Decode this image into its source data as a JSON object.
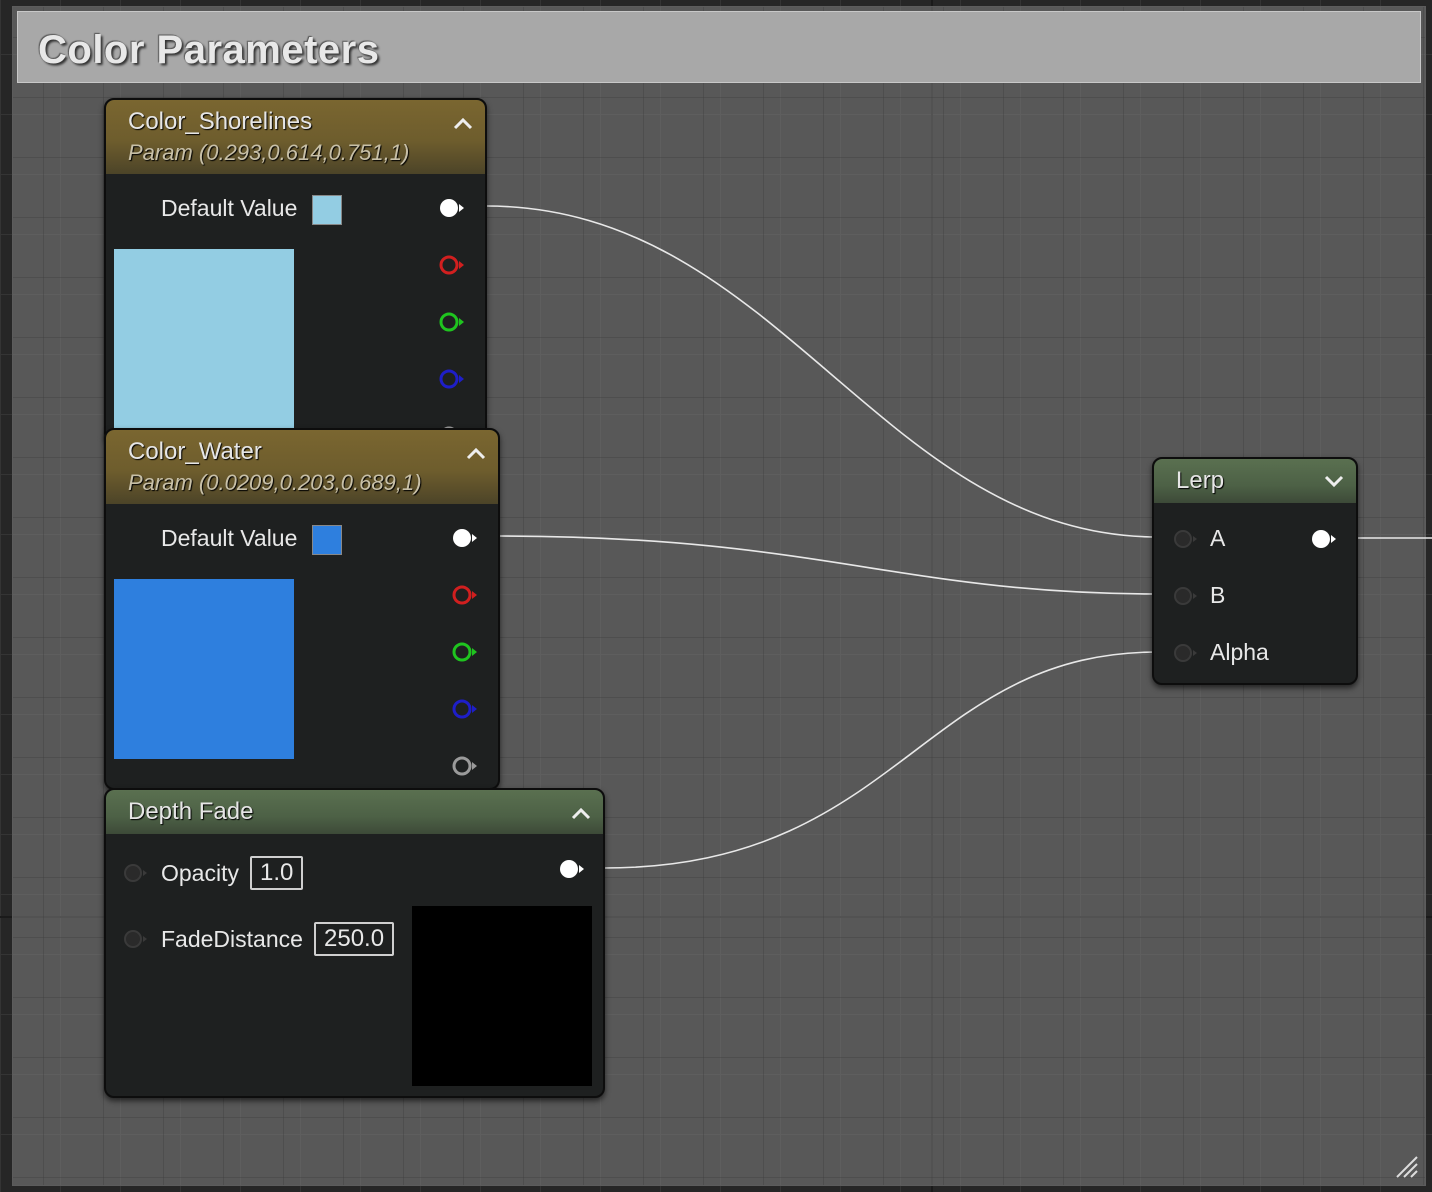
{
  "comment": {
    "title": "Color Parameters"
  },
  "nodes": {
    "shorelines": {
      "title": "Color_Shorelines",
      "subtitle": "Param (0.293,0.614,0.751,1)",
      "default_label": "Default Value",
      "color": "#93cde3"
    },
    "water": {
      "title": "Color_Water",
      "subtitle": "Param (0.0209,0.203,0.689,1)",
      "default_label": "Default Value",
      "color": "#2e7fde"
    },
    "depth_fade": {
      "title": "Depth Fade",
      "opacity_label": "Opacity",
      "opacity_value": "1.0",
      "fade_label": "FadeDistance",
      "fade_value": "250.0"
    },
    "lerp": {
      "title": "Lerp",
      "pin_a": "A",
      "pin_b": "B",
      "pin_alpha": "Alpha"
    }
  },
  "icons": {
    "pin_colors": {
      "rgba": "#ffffff",
      "r": "#d11f1f",
      "g": "#1fc41f",
      "b": "#1e1ec8",
      "a": "#9a9a9a"
    }
  }
}
